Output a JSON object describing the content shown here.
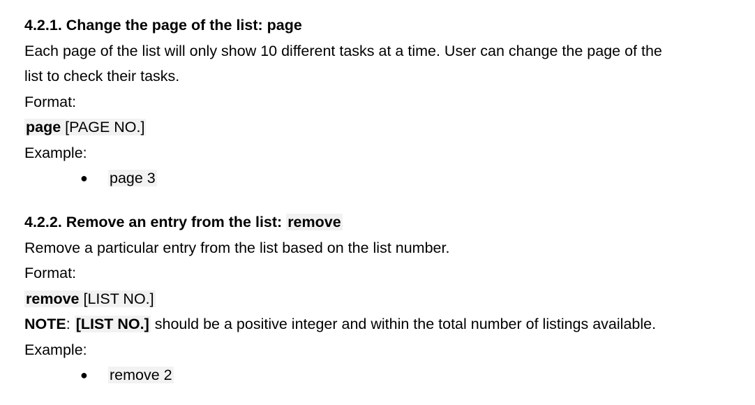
{
  "section1": {
    "heading_prefix": "4.2.1. Change the page of the list:",
    "heading_cmd": "page",
    "desc_line1": "Each page of the list will only show 10 different tasks at a time. User can change the page of the",
    "desc_line2": "list to check their tasks.",
    "format_label": "Format:",
    "format_cmd": "page",
    "format_arg": " [PAGE NO.]",
    "example_label": "Example:",
    "bullet_symbol": "●",
    "example_value": "page 3"
  },
  "section2": {
    "heading_prefix": "4.2.2. Remove an entry from the list:",
    "heading_cmd": "remove",
    "desc_line1": "Remove a particular entry from the list based on the list number.",
    "format_label": "Format:",
    "format_cmd": "remove",
    "format_arg": " [LIST NO.]",
    "note_label": "NOTE",
    "note_colon": ": ",
    "note_arg": "[LIST NO.]",
    "note_text": " should be a positive integer and within the total number of listings available.",
    "example_label": "Example:",
    "bullet_symbol": "●",
    "example_value": "remove 2"
  }
}
